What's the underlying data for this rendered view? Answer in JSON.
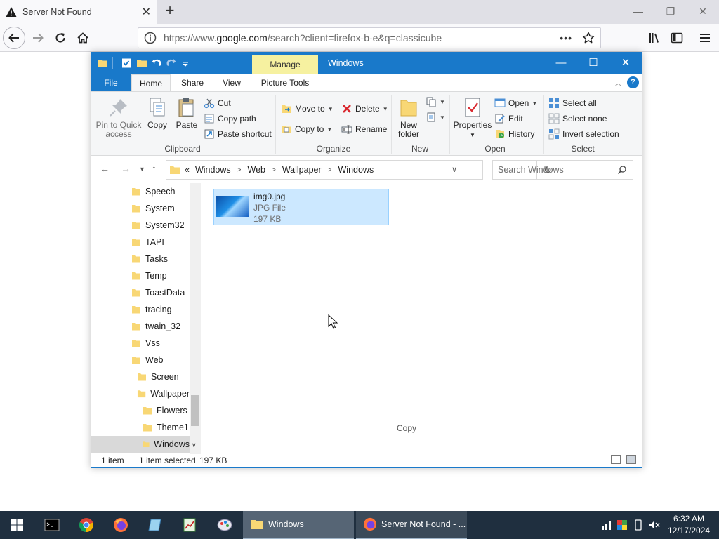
{
  "browser": {
    "tab_title": "Server Not Found",
    "url_prefix": "https://www.",
    "url_host": "google.com",
    "url_path": "/search?client=firefox-b-e&q=classicube",
    "page_actions": "•••"
  },
  "explorer": {
    "window_title": "Windows",
    "contextual_tab": "Manage",
    "tabs": [
      "File",
      "Home",
      "Share",
      "View",
      "Picture Tools"
    ],
    "ribbon": {
      "clipboard": {
        "label": "Clipboard",
        "pin": "Pin to Quick access",
        "pin_line1": "Pin to Quick",
        "pin_line2": "access",
        "copy": "Copy",
        "paste": "Paste",
        "cut": "Cut",
        "copy_path": "Copy path",
        "paste_shortcut": "Paste shortcut"
      },
      "organize": {
        "label": "Organize",
        "move_to": "Move to",
        "copy_to": "Copy to",
        "delete": "Delete",
        "rename": "Rename"
      },
      "new": {
        "label": "New",
        "new_folder_line1": "New",
        "new_folder_line2": "folder"
      },
      "open": {
        "label": "Open",
        "properties": "Properties",
        "open": "Open",
        "edit": "Edit",
        "history": "History"
      },
      "select": {
        "label": "Select",
        "select_all": "Select all",
        "select_none": "Select none",
        "invert": "Invert selection"
      }
    },
    "address": {
      "overflow": "«",
      "crumbs": [
        "Windows",
        "Web",
        "Wallpaper",
        "Windows"
      ],
      "search_placeholder": "Search Windows"
    },
    "tree": [
      {
        "label": "Speech"
      },
      {
        "label": "System"
      },
      {
        "label": "System32"
      },
      {
        "label": "TAPI"
      },
      {
        "label": "Tasks"
      },
      {
        "label": "Temp"
      },
      {
        "label": "ToastData"
      },
      {
        "label": "tracing"
      },
      {
        "label": "twain_32"
      },
      {
        "label": "Vss"
      },
      {
        "label": "Web"
      },
      {
        "label": "Screen"
      },
      {
        "label": "Wallpaper"
      },
      {
        "label": "Flowers"
      },
      {
        "label": "Theme1"
      },
      {
        "label": "Windows"
      }
    ],
    "file": {
      "name": "img0.jpg",
      "type": "JPG File",
      "size": "197 KB"
    },
    "drag_hint": "Copy",
    "status": {
      "count": "1 item",
      "selected": "1 item selected",
      "size": "197 KB"
    }
  },
  "taskbar": {
    "explorer_task": "Windows",
    "firefox_task": "Server Not Found - ...",
    "time": "6:32 AM",
    "date": "12/17/2024"
  }
}
